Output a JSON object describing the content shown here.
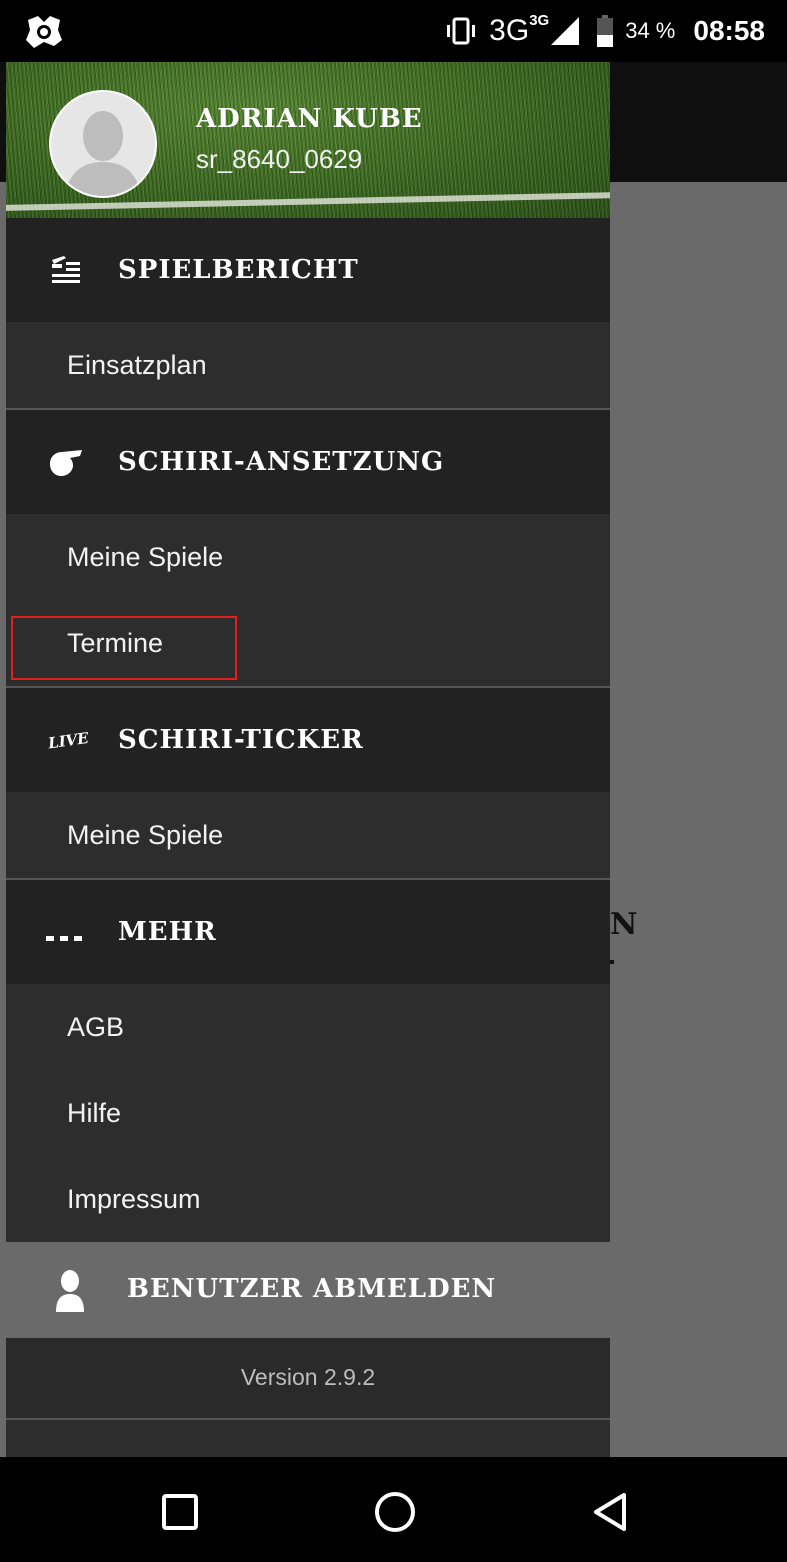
{
  "status_bar": {
    "network": "3G",
    "network_badge": "3G",
    "battery_percent": "34 %",
    "time": "08:58"
  },
  "profile": {
    "name": "ADRIAN KUBE",
    "username": "sr_8640_0629"
  },
  "menu": {
    "spielbericht": {
      "title": "SPIELBERICHT",
      "icon": "report-icon",
      "items": [
        "Einsatzplan"
      ]
    },
    "schiri_ansetzung": {
      "title": "SCHIRI-ANSETZUNG",
      "icon": "whistle-icon",
      "items": [
        "Meine Spiele",
        "Termine"
      ]
    },
    "schiri_ticker": {
      "title": "SCHIRI-TICKER",
      "icon_text": "LIVE",
      "items": [
        "Meine Spiele"
      ]
    },
    "mehr": {
      "title": "MEHR",
      "icon_text": "...",
      "items": [
        "AGB",
        "Hilfe",
        "Impressum"
      ]
    }
  },
  "logout": {
    "label": "BENUTZER ABMELDEN",
    "icon": "user-icon"
  },
  "version": "Version 2.9.2",
  "background": {
    "fragment": "N"
  },
  "colors": {
    "section_bg": "#222222",
    "item_bg": "#2d2d2d",
    "logout_bg": "#6a6a6a",
    "highlight": "#e02020"
  }
}
